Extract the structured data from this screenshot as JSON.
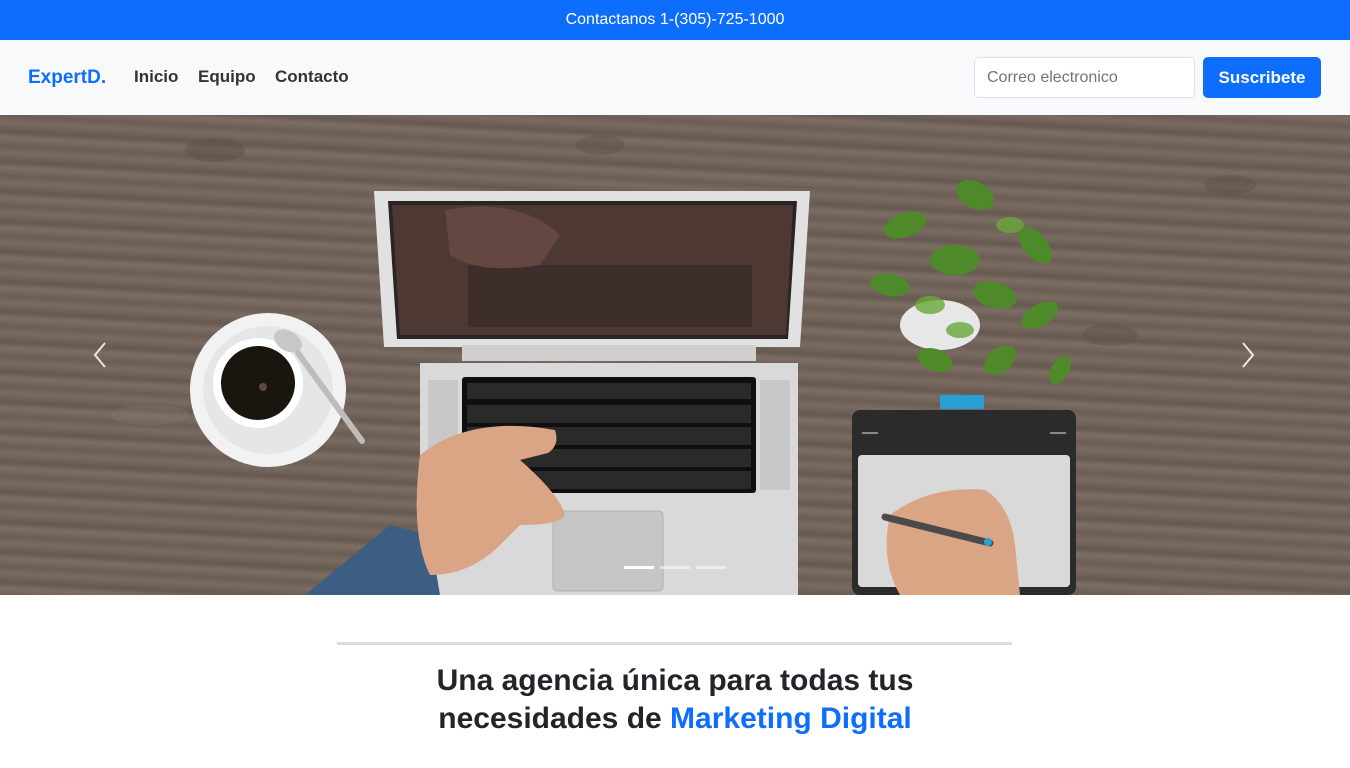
{
  "topbar": {
    "text": "Contactanos 1-(305)-725-1000"
  },
  "navbar": {
    "brand": "ExpertD.",
    "links": [
      "Inicio",
      "Equipo",
      "Contacto"
    ],
    "email_placeholder": "Correo electronico",
    "subscribe_label": "Suscribete"
  },
  "carousel": {
    "slide_count": 3,
    "active_slide": 1,
    "prev_icon": "chevron-left-icon",
    "next_icon": "chevron-right-icon"
  },
  "headline": {
    "line1": "Una agencia única para todas tus",
    "line2_prefix": "necesidades de ",
    "line2_accent": "Marketing Digital"
  },
  "colors": {
    "primary": "#0d6efd",
    "navbar_bg": "#f8f9fa",
    "text": "#212529"
  }
}
